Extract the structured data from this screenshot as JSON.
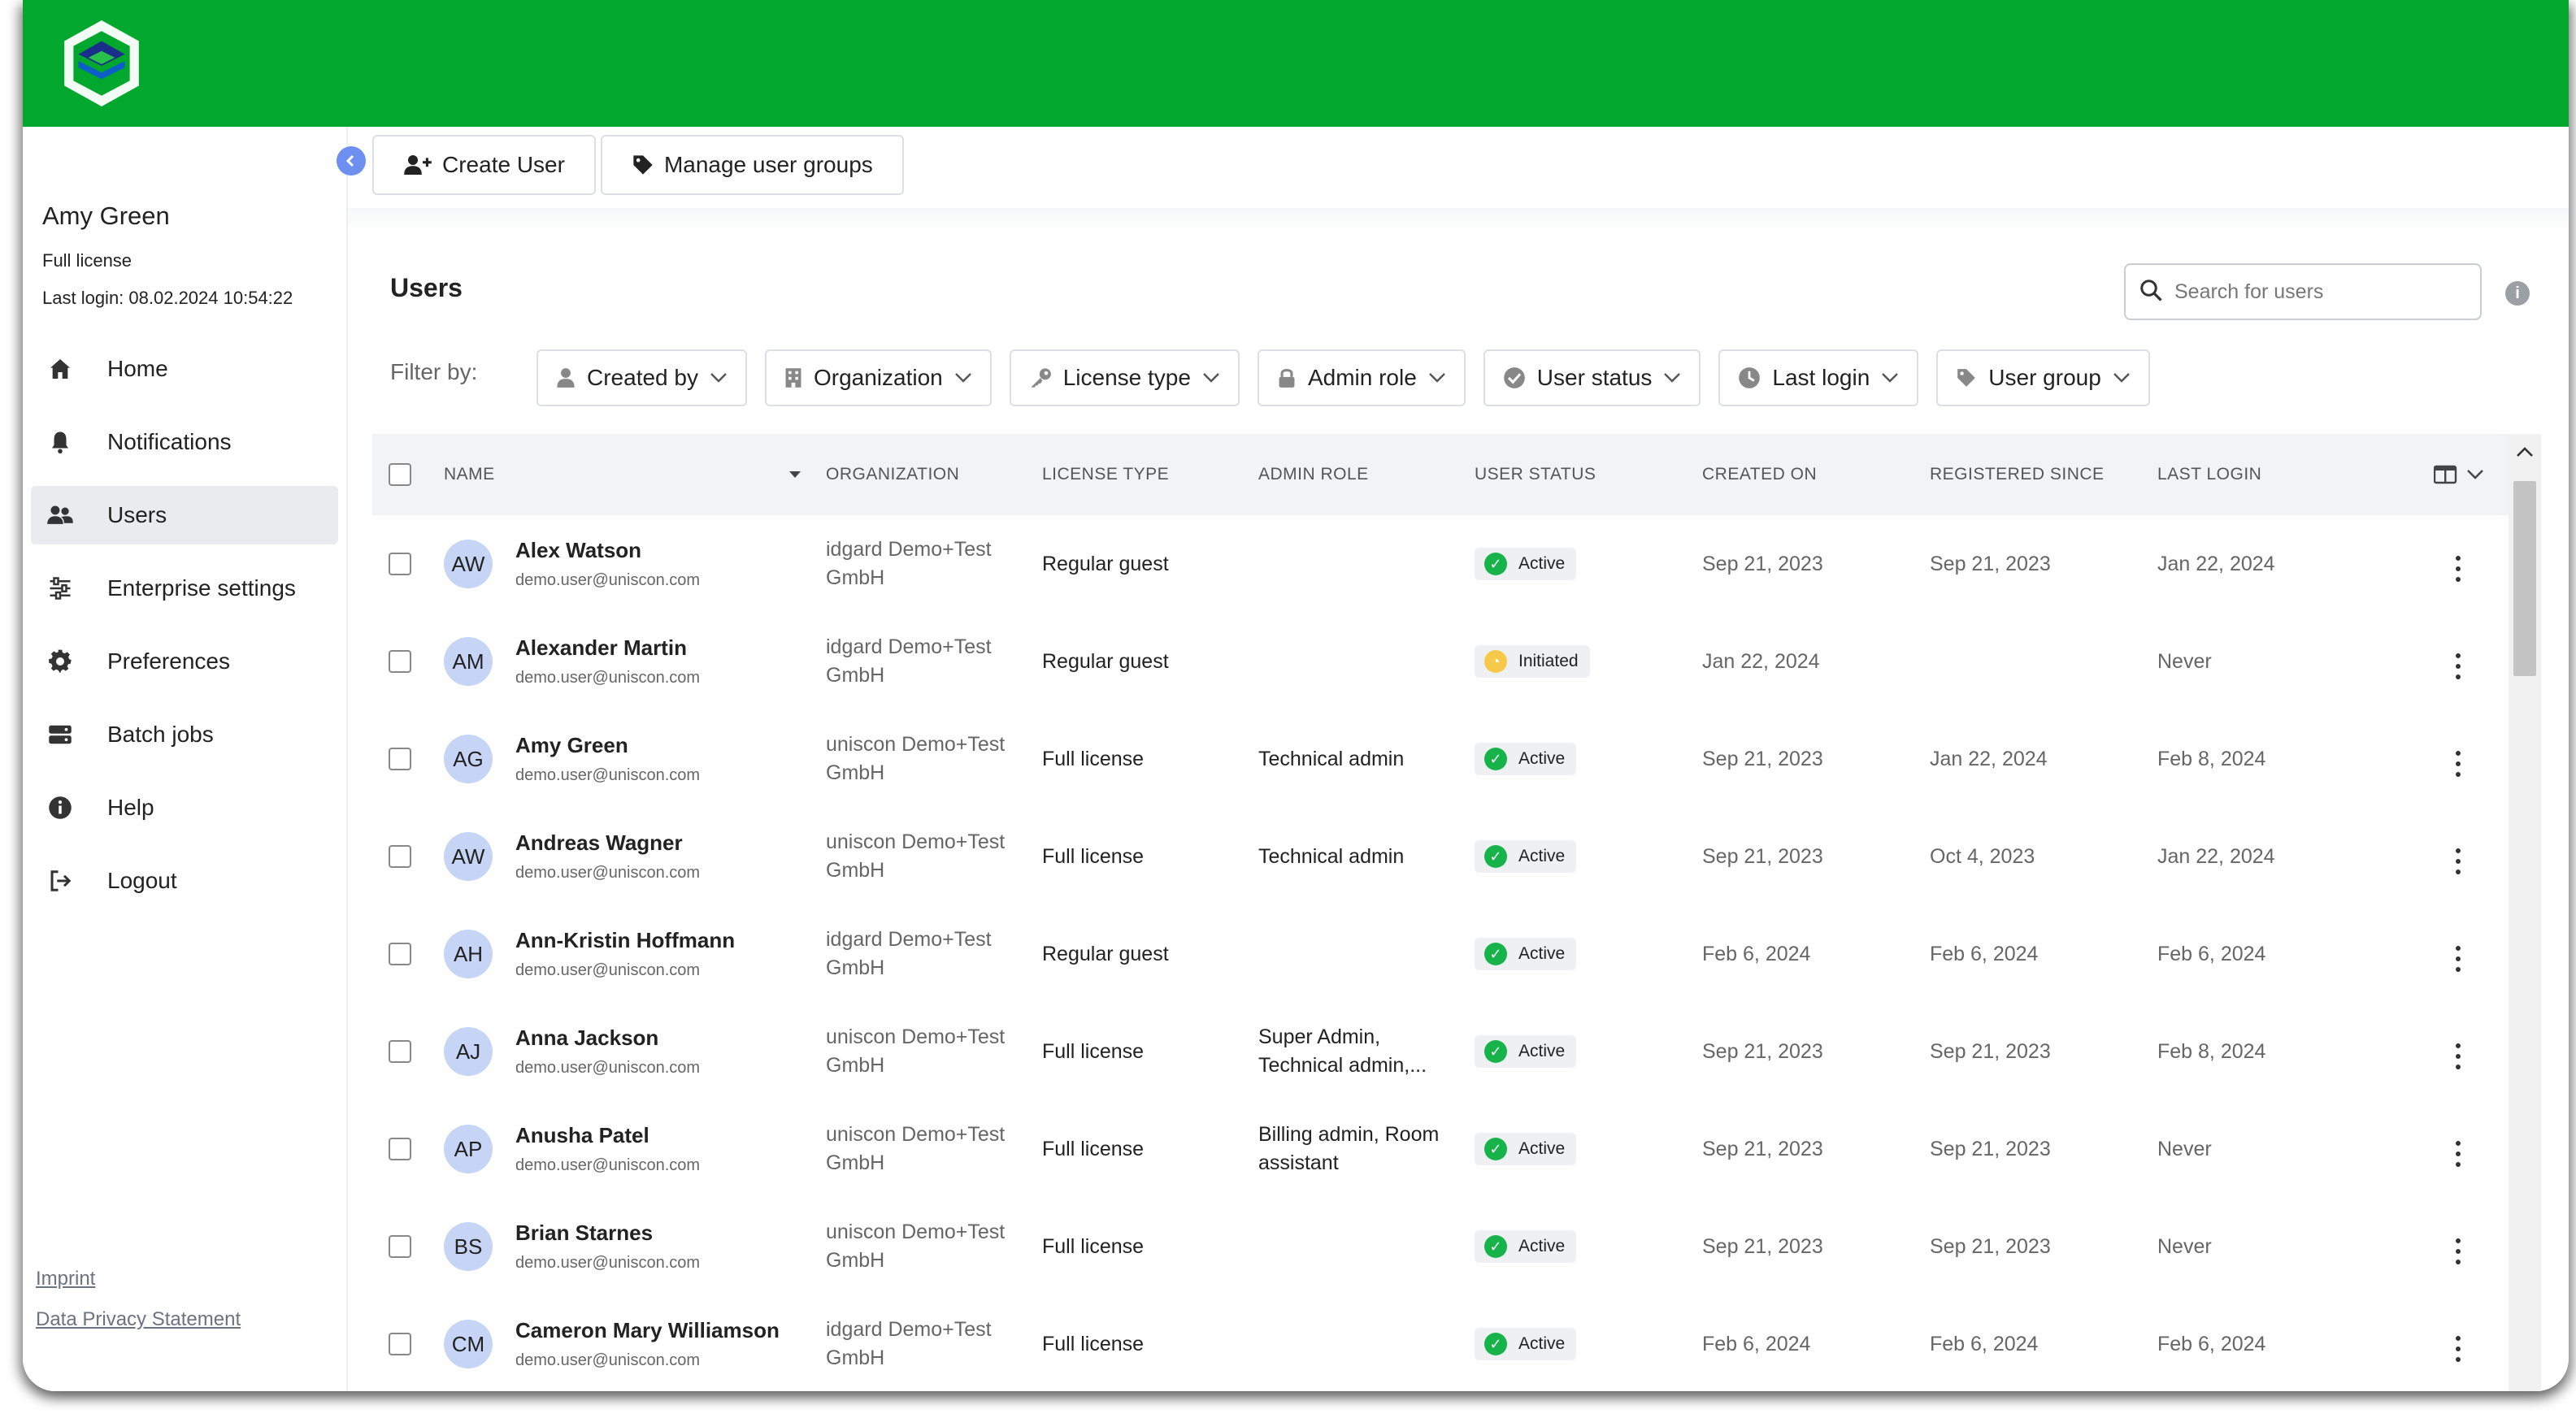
{
  "toolbar": {
    "create_user": "Create User",
    "manage_groups": "Manage user groups"
  },
  "sidebar": {
    "user_name": "Amy Green",
    "license": "Full license",
    "last_login": "Last login: 08.02.2024 10:54:22",
    "items": [
      {
        "label": "Home",
        "icon": "home-icon",
        "active": false
      },
      {
        "label": "Notifications",
        "icon": "bell-icon",
        "active": false
      },
      {
        "label": "Users",
        "icon": "users-icon",
        "active": true
      },
      {
        "label": "Enterprise settings",
        "icon": "sliders-icon",
        "active": false
      },
      {
        "label": "Preferences",
        "icon": "gear-icon",
        "active": false
      },
      {
        "label": "Batch jobs",
        "icon": "server-icon",
        "active": false
      },
      {
        "label": "Help",
        "icon": "info-icon",
        "active": false
      },
      {
        "label": "Logout",
        "icon": "logout-icon",
        "active": false
      }
    ],
    "footer": {
      "imprint": "Imprint",
      "privacy": "Data Privacy Statement"
    }
  },
  "main": {
    "title": "Users",
    "search_placeholder": "Search for users",
    "filter_label": "Filter by:",
    "filters": [
      {
        "label": "Created by",
        "icon": "person-icon"
      },
      {
        "label": "Organization",
        "icon": "building-icon"
      },
      {
        "label": "License type",
        "icon": "key-icon"
      },
      {
        "label": "Admin role",
        "icon": "lock-icon"
      },
      {
        "label": "User status",
        "icon": "check-circle-icon"
      },
      {
        "label": "Last login",
        "icon": "clock-icon"
      },
      {
        "label": "User group",
        "icon": "tag-icon"
      }
    ],
    "columns": {
      "name": "NAME",
      "organization": "ORGANIZATION",
      "license_type": "LICENSE TYPE",
      "admin_role": "ADMIN ROLE",
      "user_status": "USER STATUS",
      "created_on": "CREATED ON",
      "registered_since": "REGISTERED SINCE",
      "last_login": "LAST LOGIN"
    },
    "colors": {
      "brand": "#02a72d",
      "active": "#16b34a",
      "initiated": "#f7c948"
    },
    "rows": [
      {
        "initials": "AW",
        "name": "Alex Watson",
        "email": "demo.user@uniscon.com",
        "org1": "idgard Demo+Test",
        "org2": "GmbH",
        "license": "Regular guest",
        "role1": "",
        "role2": "",
        "status": "Active",
        "created": "Sep 21, 2023",
        "registered": "Sep 21, 2023",
        "last_login": "Jan 22, 2024"
      },
      {
        "initials": "AM",
        "name": "Alexander Martin",
        "email": "demo.user@uniscon.com",
        "org1": "idgard Demo+Test",
        "org2": "GmbH",
        "license": "Regular guest",
        "role1": "",
        "role2": "",
        "status": "Initiated",
        "created": "Jan 22, 2024",
        "registered": "",
        "last_login": "Never"
      },
      {
        "initials": "AG",
        "name": "Amy Green",
        "email": "demo.user@uniscon.com",
        "org1": "uniscon Demo+Test",
        "org2": "GmbH",
        "license": "Full license",
        "role1": "Technical admin",
        "role2": "",
        "status": "Active",
        "created": "Sep 21, 2023",
        "registered": "Jan 22, 2024",
        "last_login": "Feb 8, 2024"
      },
      {
        "initials": "AW",
        "name": "Andreas Wagner",
        "email": "demo.user@uniscon.com",
        "org1": "uniscon Demo+Test",
        "org2": "GmbH",
        "license": "Full license",
        "role1": "Technical admin",
        "role2": "",
        "status": "Active",
        "created": "Sep 21, 2023",
        "registered": "Oct 4, 2023",
        "last_login": "Jan 22, 2024"
      },
      {
        "initials": "AH",
        "name": "Ann-Kristin Hoffmann",
        "email": "demo.user@uniscon.com",
        "org1": "idgard Demo+Test",
        "org2": "GmbH",
        "license": "Regular guest",
        "role1": "",
        "role2": "",
        "status": "Active",
        "created": "Feb 6, 2024",
        "registered": "Feb 6, 2024",
        "last_login": "Feb 6, 2024"
      },
      {
        "initials": "AJ",
        "name": "Anna Jackson",
        "email": "demo.user@uniscon.com",
        "org1": "uniscon Demo+Test",
        "org2": "GmbH",
        "license": "Full license",
        "role1": "Super Admin,",
        "role2": "Technical admin,...",
        "status": "Active",
        "created": "Sep 21, 2023",
        "registered": "Sep 21, 2023",
        "last_login": "Feb 8, 2024"
      },
      {
        "initials": "AP",
        "name": "Anusha Patel",
        "email": "demo.user@uniscon.com",
        "org1": "uniscon Demo+Test",
        "org2": "GmbH",
        "license": "Full license",
        "role1": "Billing admin, Room",
        "role2": "assistant",
        "status": "Active",
        "created": "Sep 21, 2023",
        "registered": "Sep 21, 2023",
        "last_login": "Never"
      },
      {
        "initials": "BS",
        "name": "Brian Starnes",
        "email": "demo.user@uniscon.com",
        "org1": "uniscon Demo+Test",
        "org2": "GmbH",
        "license": "Full license",
        "role1": "",
        "role2": "",
        "status": "Active",
        "created": "Sep 21, 2023",
        "registered": "Sep 21, 2023",
        "last_login": "Never"
      },
      {
        "initials": "CM",
        "name": "Cameron Mary Williamson",
        "email": "demo.user@uniscon.com",
        "org1": "idgard Demo+Test",
        "org2": "GmbH",
        "license": "Full license",
        "role1": "",
        "role2": "",
        "status": "Active",
        "created": "Feb 6, 2024",
        "registered": "Feb 6, 2024",
        "last_login": "Feb 6, 2024"
      }
    ]
  }
}
